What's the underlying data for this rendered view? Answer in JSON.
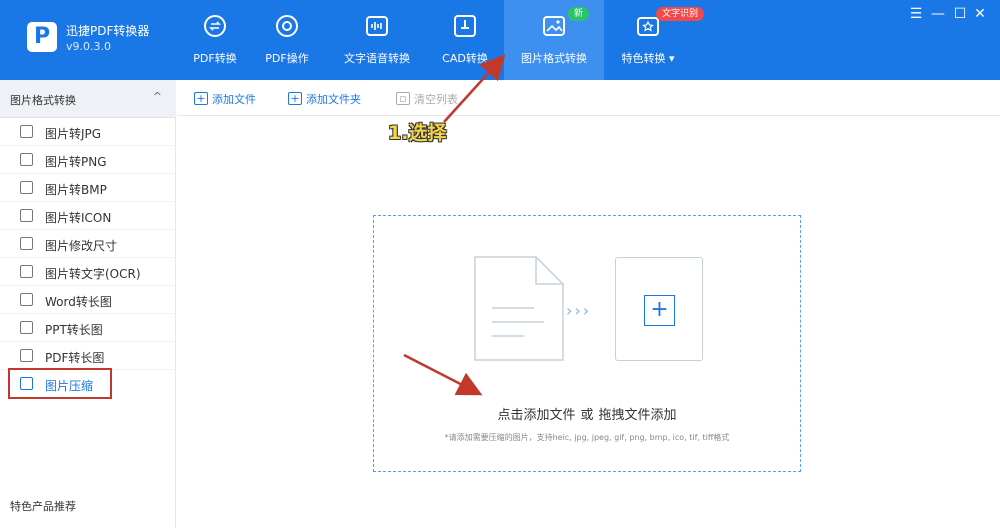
{
  "app": {
    "name": "迅捷PDF转换器",
    "version": "v9.0.3.0"
  },
  "tabs": [
    {
      "label": "PDF转换"
    },
    {
      "label": "PDF操作"
    },
    {
      "label": "文字语音转换"
    },
    {
      "label": "CAD转换"
    },
    {
      "label": "图片格式转换",
      "badge": "新"
    },
    {
      "label": "特色转换 ▾",
      "badge": "文字识别"
    }
  ],
  "window_controls": {
    "menu": "☰",
    "minimize": "—",
    "maximize": "☐",
    "close": "✕"
  },
  "sidebar": {
    "header": "图片格式转换",
    "chevron": "^",
    "items": [
      {
        "label": "图片转JPG"
      },
      {
        "label": "图片转PNG"
      },
      {
        "label": "图片转BMP"
      },
      {
        "label": "图片转ICON"
      },
      {
        "label": "图片修改尺寸"
      },
      {
        "label": "图片转文字(OCR)"
      },
      {
        "label": "Word转长图"
      },
      {
        "label": "PPT转长图"
      },
      {
        "label": "PDF转长图"
      },
      {
        "label": "图片压缩"
      }
    ],
    "footer": "特色产品推荐"
  },
  "toolbar": {
    "add_file": "添加文件",
    "add_folder": "添加文件夹",
    "clear_list": "清空列表"
  },
  "dropzone": {
    "arrows": "›››",
    "action_click": "点击添加文件",
    "or": "或",
    "action_drag": "拖拽文件添加",
    "hint": "*请添加需要压缩的图片，支持heic, jpg, jpeg, gif, png, bmp, ico, tif, tiff格式"
  },
  "annotation": {
    "step_text": "1.选择",
    "color": "#c0392b"
  },
  "colors": {
    "accent": "#1a77e6",
    "new_badge": "#2cc46a",
    "ocr_badge": "#f24a4a"
  }
}
